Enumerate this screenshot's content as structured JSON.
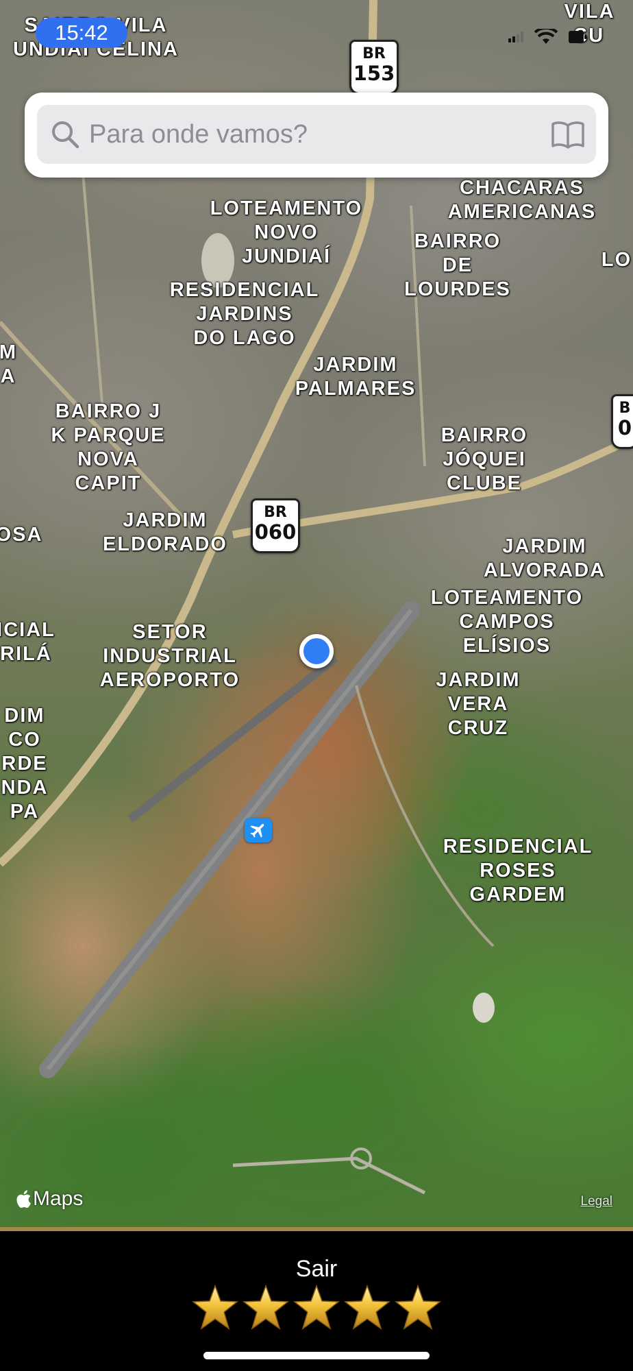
{
  "status_bar": {
    "time": "15:42"
  },
  "search": {
    "placeholder": "Para onde vamos?",
    "value": ""
  },
  "map": {
    "places": [
      "SAIRRO  VILA\nUNDIAÍ CELINA",
      "VILA SU",
      "LOTEAMENTO\nNOVO\nJUNDIAÍ",
      "CHACARAS\nAMERICANAS",
      "BAIRRO\nDE\nLOURDES",
      "LO",
      "RESIDENCIAL\nJARDINS\nDO LAGO",
      "JARDIM\nPALMARES",
      "M\nA",
      "BAIRRO J\nK PARQUE\nNOVA\nCAPIT",
      "BAIRRO\nJÓQUEI\nCLUBE",
      "JARDIM\nELDORADO",
      "OSA",
      "JARDIM\nALVORADA",
      "LOTEAMENTO\nCAMPOS\nELÍSIOS",
      "SETOR\nINDUSTRIAL\nAEROPORTO",
      "ICIAL\nRILÁ",
      "JARDIM\nVERA\nCRUZ",
      "DIM\nCO\nRDE\nNDA\nPA",
      "RESIDENCIAL\nROSES\nGARDEM"
    ],
    "shields": [
      {
        "code": "BR",
        "number": "153"
      },
      {
        "code": "BR",
        "number": "060"
      },
      {
        "code": "B",
        "number": "0"
      }
    ],
    "brand": "Maps",
    "legal": "Legal"
  },
  "bottom_panel": {
    "exit_label": "Sair",
    "rating": 5,
    "max_rating": 5
  },
  "icons": {
    "search": "search-icon",
    "book": "book-icon",
    "location": "current-location-dot",
    "airport": "airplane-icon",
    "apple": "apple-icon",
    "star": "star-icon"
  },
  "colors": {
    "accent": "#2f6ff0",
    "location": "#2f7ef6",
    "gold": "#a3894a",
    "star": "#e8b62a"
  }
}
